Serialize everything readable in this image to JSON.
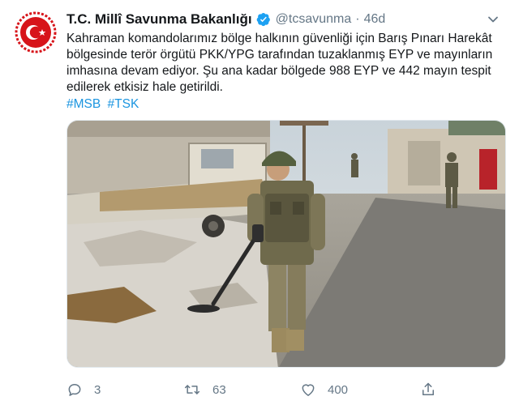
{
  "account": {
    "name": "T.C. Millî Savunma Bakanlığı",
    "handle": "@tcsavunma",
    "separator": "·",
    "time": "46d",
    "verified": true,
    "avatar_icon": "turkish-armed-forces-emblem-icon"
  },
  "tweet": {
    "lines": [
      "Kahraman komandolarımız bölge halkının güvenliği için Barış Pınarı Harekât",
      "bölgesinde terör örgütü PKK/YPG tarafından tuzaklanmış EYP ve mayınların",
      "imhasına devam ediyor. Şu ana kadar bölgede 988 EYP ve 442 mayın tespit",
      "edilerek etkisiz hale getirildi."
    ],
    "hashtags": [
      "#MSB",
      "#TSK"
    ]
  },
  "actions": {
    "replies": "3",
    "retweets": "63",
    "likes": "400"
  },
  "colors": {
    "text": "#14171a",
    "muted": "#657786",
    "link": "#1b95e0",
    "verified": "#1da1f2",
    "emblem_red": "#d7141a"
  }
}
